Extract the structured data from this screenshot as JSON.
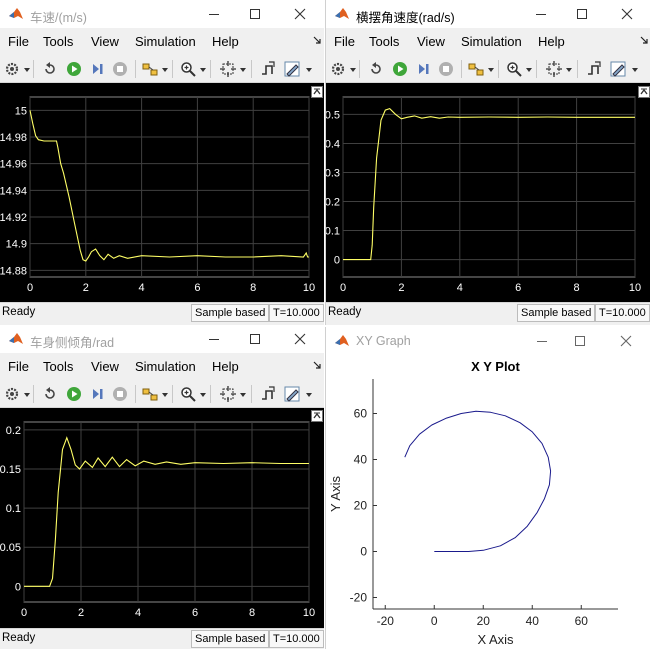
{
  "scopes": [
    {
      "title": "车速/(m/s)",
      "active": false,
      "status": {
        "ready": "Ready",
        "sample": "Sample based",
        "time": "T=10.000"
      },
      "plot": {
        "xlim": [
          0,
          10
        ],
        "ylim": [
          14.875,
          15.01
        ],
        "xticks": [
          "0",
          "2",
          "4",
          "6",
          "8",
          "10"
        ],
        "yticks": [
          {
            "v": 15.0,
            "label": "15"
          },
          {
            "v": 14.98,
            "label": "14.98"
          },
          {
            "v": 14.96,
            "label": "14.96"
          },
          {
            "v": 14.94,
            "label": "14.94"
          },
          {
            "v": 14.92,
            "label": "14.92"
          },
          {
            "v": 14.9,
            "label": "14.9"
          },
          {
            "v": 14.88,
            "label": "14.88"
          }
        ],
        "x": [
          0,
          0.1,
          0.2,
          0.3,
          0.5,
          0.8,
          0.95,
          1.0,
          1.1,
          1.2,
          1.4,
          1.6,
          1.8,
          1.9,
          2.0,
          2.1,
          2.2,
          2.35,
          2.5,
          2.65,
          2.8,
          3.0,
          3.2,
          3.5,
          4,
          5,
          6,
          7,
          8,
          9,
          9.8,
          9.9,
          9.95,
          10
        ],
        "y": [
          15.0,
          14.99,
          14.981,
          14.978,
          14.977,
          14.977,
          14.977,
          14.972,
          14.96,
          14.953,
          14.935,
          14.915,
          14.895,
          14.888,
          14.887,
          14.89,
          14.894,
          14.896,
          14.891,
          14.888,
          14.892,
          14.889,
          14.891,
          14.889,
          14.891,
          14.89,
          14.891,
          14.89,
          14.89,
          14.891,
          14.89,
          14.893,
          14.89,
          14.89
        ]
      }
    },
    {
      "title": "横摆角速度(rad/s)",
      "active": true,
      "status": {
        "ready": "Ready",
        "sample": "Sample based",
        "time": "T=10.000"
      },
      "plot": {
        "xlim": [
          0,
          10
        ],
        "ylim": [
          -0.06,
          0.56
        ],
        "xticks": [
          "0",
          "2",
          "4",
          "6",
          "8",
          "10"
        ],
        "yticks": [
          {
            "v": 0.5,
            "label": "0.5"
          },
          {
            "v": 0.4,
            "label": "0.4"
          },
          {
            "v": 0.3,
            "label": "0.3"
          },
          {
            "v": 0.2,
            "label": "0.2"
          },
          {
            "v": 0.1,
            "label": "0.1"
          },
          {
            "v": 0.0,
            "label": "0"
          }
        ],
        "x": [
          0,
          0.95,
          1.0,
          1.05,
          1.15,
          1.3,
          1.45,
          1.6,
          1.8,
          2.0,
          2.2,
          2.45,
          2.7,
          3.0,
          3.3,
          3.6,
          4.0,
          5,
          6,
          7,
          8,
          9,
          10
        ],
        "y": [
          0,
          0,
          0.05,
          0.18,
          0.35,
          0.48,
          0.515,
          0.52,
          0.5,
          0.485,
          0.49,
          0.495,
          0.487,
          0.492,
          0.487,
          0.491,
          0.49,
          0.491,
          0.49,
          0.491,
          0.49,
          0.49,
          0.49
        ]
      }
    },
    {
      "title": "车身侧倾角/rad",
      "active": false,
      "status": {
        "ready": "Ready",
        "sample": "Sample based",
        "time": "T=10.000"
      },
      "plot": {
        "xlim": [
          0,
          10
        ],
        "ylim": [
          -0.02,
          0.21
        ],
        "xticks": [
          "0",
          "2",
          "4",
          "6",
          "8",
          "10"
        ],
        "yticks": [
          {
            "v": 0.2,
            "label": "0.2"
          },
          {
            "v": 0.15,
            "label": "0.15"
          },
          {
            "v": 0.1,
            "label": "0.1"
          },
          {
            "v": 0.05,
            "label": "0.05"
          },
          {
            "v": 0.0,
            "label": "0"
          }
        ],
        "x": [
          0,
          0.9,
          1.0,
          1.1,
          1.2,
          1.35,
          1.5,
          1.65,
          1.8,
          1.95,
          2.15,
          2.4,
          2.6,
          2.85,
          3.1,
          3.35,
          3.6,
          3.9,
          4.2,
          4.6,
          5.0,
          5.5,
          6,
          7,
          8,
          9,
          10
        ],
        "y": [
          0,
          0,
          0.01,
          0.06,
          0.12,
          0.175,
          0.19,
          0.175,
          0.155,
          0.15,
          0.16,
          0.152,
          0.164,
          0.153,
          0.165,
          0.153,
          0.162,
          0.154,
          0.16,
          0.156,
          0.159,
          0.156,
          0.158,
          0.157,
          0.158,
          0.157,
          0.157
        ]
      }
    }
  ],
  "menu": {
    "file": "File",
    "tools": "Tools",
    "view": "View",
    "simulation": "Simulation",
    "help": "Help"
  },
  "xy_graph": {
    "window_title": "XY Graph",
    "chart_data": {
      "type": "line",
      "title": "X Y Plot",
      "xlabel": "X Axis",
      "ylabel": "Y Axis",
      "xlim": [
        -25,
        75
      ],
      "ylim": [
        -25,
        75
      ],
      "xticks": [
        -20,
        0,
        20,
        40,
        60
      ],
      "yticks": [
        -20,
        0,
        20,
        40,
        60
      ],
      "series": [
        {
          "color": "#1a1a8c",
          "x": [
            0,
            8,
            14,
            20,
            27,
            33,
            38,
            42,
            45,
            47,
            47.5,
            46.5,
            44,
            40,
            35,
            29,
            23,
            17,
            11,
            5,
            -1,
            -6,
            -10,
            -12
          ],
          "y": [
            0,
            0,
            0,
            0.5,
            2.5,
            6,
            11,
            17,
            23,
            29,
            35,
            41,
            47,
            52,
            56,
            59,
            60.5,
            61,
            60,
            58,
            55,
            51,
            46,
            41
          ]
        }
      ]
    }
  },
  "colors": {
    "trace": "#ffff66",
    "grid": "#404040",
    "plot_bg": "#000000",
    "axis_text": "#ffffff"
  },
  "icons": [
    "matlab-logo-icon",
    "minimize-icon",
    "maximize-icon",
    "close-icon",
    "settings-gear-icon",
    "restore-icon",
    "run-icon",
    "step-forward-icon",
    "stop-icon",
    "highlight-icon",
    "zoom-icon",
    "fit-icon",
    "triggers-icon",
    "style-icon"
  ]
}
